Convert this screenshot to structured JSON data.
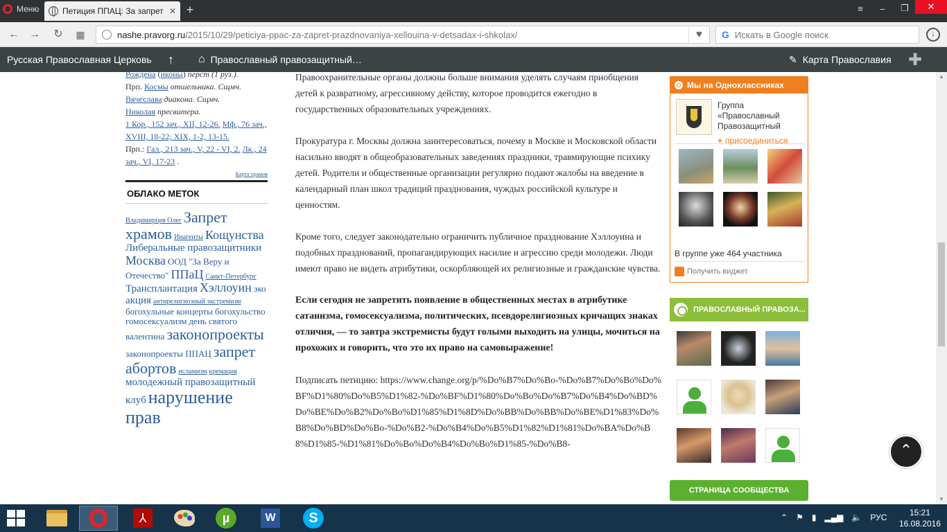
{
  "browser": {
    "menu_label": "Меню",
    "tab_title": "Петиция ППАЦ: За запрет",
    "address_host": "nashe.pravorg.ru",
    "address_path": "/2015/10/29/peticiya-ppac-za-zapret-prazdnovaniya-xellouina-v-detsadax-i-shkolax/",
    "search_placeholder": "Искать в Google поиск"
  },
  "sitebar": {
    "item1": "Русская Православная Церковь",
    "item2": "Православный правозащитный…",
    "item3": "Карта Православия"
  },
  "left": {
    "line1_a": "Рождена",
    "line1_b": "иконы",
    "line1_c": "перст (1 руз.).",
    "line2_a": "Прп.",
    "line2_b": "Космы",
    "line2_c": "отшельника. Сщмч.",
    "line3_a": "Вячеслава",
    "line3_b": "диакона. Сщмч.",
    "line4_a": "Николая",
    "line4_b": "пресвитера.",
    "reading1": "1 Кор., 152 зач., XII, 12-26.",
    "reading2": "Мф., 76 зач., XVIII, 18-22; XIX, 1-2, 13-15.",
    "reading3_a": "Прп.:",
    "reading3_b": "Гал., 213 зач., V, 22 - VI, 2.",
    "reading3_c": "Лк., 24 зач., VI, 17-23",
    "reading3_d": ".",
    "map_link": "Карта храмов",
    "tags_title": "ОБЛАКО МЕТОК",
    "tags": [
      "Владимирцев Олег",
      "Запрет храмов",
      "Инагенты",
      "Кощунства",
      "Либеральные правозащитники",
      "Москва",
      "ООД \"За Веру и Отечество\"",
      "ППаЦ",
      "Санкт-Петербург",
      "Трансплантация",
      "Хэллоуин",
      "эко",
      "акция",
      "антирелигиозный экстремизм",
      "богохульные концерты",
      "богохульство",
      "гомосексуализм",
      "день святого валентина",
      "законопроекты",
      "законопроекты ППАЦ",
      "запрет абортов",
      "исламизм",
      "кремация",
      "молодежный правозащитный клуб",
      "нарушение прав"
    ]
  },
  "article": {
    "p1": "Правоохранительные органы должны больше внимания уделять случаям приобщения детей к развратному, агрессивному действу, которое проводится ежегодно в государственных образовательных учреждениях.",
    "p2": "Прокуратура г. Москвы должна заинтересоваться, почему в Москве и Московской области насильно вводят в общеобразовательных заведениях праздники, травмирующие психику детей. Родители и общественные организации регулярно подают жалобы на введение в календарный план школ традиций празднования,  чуждых российской культуре и ценностям.",
    "p3": "Кроме того, следует законодательно ограничить публичное празднование Хэллоуина и подобных празднований, пропагандирующих насилие и агрессию среди молодежи. Люди имеют право не видеть атрибутики, оскорбляющей их религиозные и гражданские чувства.",
    "p4": "Если сегодня не запретить появление в общественных местах в атрибутике сатанизма, гомосексуализма, политических, псевдорелигиозных кричащих знаках отличия, — то завтра экстремисты будут голыми выходить на улицы, мочиться на прохожих и говорить, что это их право на самовыражение!",
    "p5_label": "Подписать петицию:",
    "p5_url": "https://www.change.org/p/%Do%B7%Do%Bo-%Do%B7%Do%Bo%Do%BF%D1%80%Do%B5%D1%82-%Do%BF%D1%80%Do%Bo%Do%B7%Do%B4%Do%BD%Do%BE%Do%B2%Do%Bo%D1%85%D1%8D%Do%BB%Do%BB%Do%BE%D1%83%Do%B8%Do%BD%Do%Bo-%Do%B2-%Do%B4%Do%B5%D1%82%D1%81%Do%BA%Do%B8%D1%85-%D1%81%Do%Bo%Do%B4%Do%Bo%D1%85-%Do%B8-"
  },
  "ok_widget": {
    "header": "Мы на Одноклассниках",
    "group_name": "Группа «Православный Правозащитный",
    "join": "присоединиться",
    "members": "В группе уже 464 участника",
    "get_widget": "Получить виджет"
  },
  "vk_widget": {
    "header": "ПРАВОСЛАВНЫЙ ПРАВОЗА...",
    "button": "СТРАНИЦА СООБЩЕСТВА"
  },
  "taskbar": {
    "lang": "РУС",
    "time": "15:21",
    "date": "16.08.2016"
  },
  "colors": {
    "ok_orange": "#f07f1f",
    "vk_green": "#8cbd3b",
    "link_blue": "#2a5e9c",
    "site_bar": "#3c4345"
  }
}
